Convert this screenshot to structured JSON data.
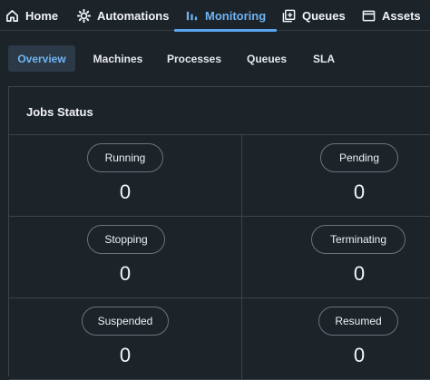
{
  "topnav": {
    "items": [
      {
        "label": "Home",
        "icon": "home-icon",
        "active": false
      },
      {
        "label": "Automations",
        "icon": "gear-icon",
        "active": false
      },
      {
        "label": "Monitoring",
        "icon": "bar-chart-icon",
        "active": true
      },
      {
        "label": "Queues",
        "icon": "queue-icon",
        "active": false
      },
      {
        "label": "Assets",
        "icon": "window-icon",
        "active": false
      }
    ]
  },
  "subtabs": {
    "items": [
      {
        "label": "Overview",
        "active": true
      },
      {
        "label": "Machines",
        "active": false
      },
      {
        "label": "Processes",
        "active": false
      },
      {
        "label": "Queues",
        "active": false
      },
      {
        "label": "SLA",
        "active": false
      }
    ]
  },
  "jobs_status": {
    "title": "Jobs Status",
    "cells": [
      {
        "label": "Running",
        "count": "0"
      },
      {
        "label": "Pending",
        "count": "0"
      },
      {
        "label": "Stopping",
        "count": "0"
      },
      {
        "label": "Terminating",
        "count": "0"
      },
      {
        "label": "Suspended",
        "count": "0"
      },
      {
        "label": "Resumed",
        "count": "0"
      }
    ]
  },
  "colors": {
    "background": "#1c2329",
    "accent": "#5aa6ee",
    "active_tab_bg": "#2c3a47",
    "border": "#3a444d"
  }
}
